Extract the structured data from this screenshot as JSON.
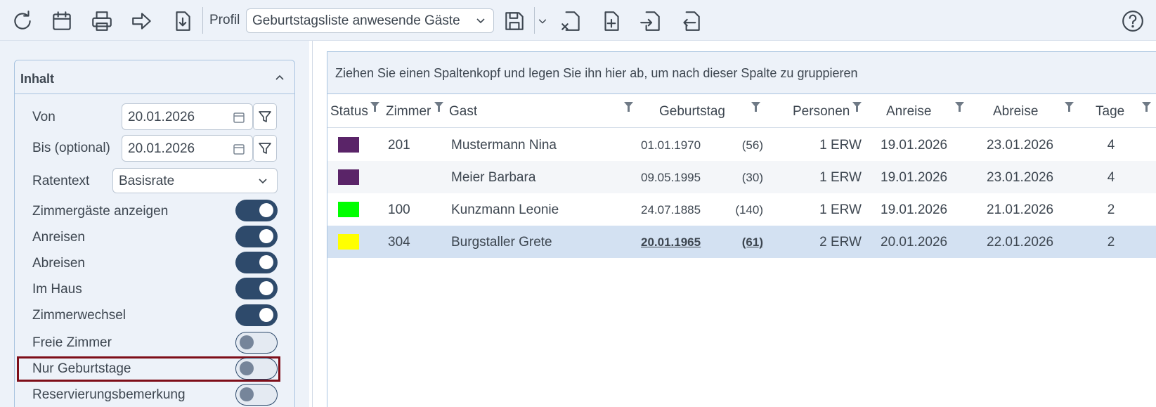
{
  "toolbar": {
    "icons": [
      "refresh-icon",
      "calendar-icon",
      "print-icon",
      "forward-icon",
      "download-icon",
      "save-icon",
      "excel-export-icon",
      "new-file-icon",
      "import-icon",
      "export-icon",
      "help-icon"
    ],
    "profil_label": "Profil",
    "profil_value": "Geburtstagsliste anwesende Gäste"
  },
  "panel": {
    "title": "Inhalt",
    "von_label": "Von",
    "von_value": "20.01.2026",
    "bis_label": "Bis (optional)",
    "bis_value": "20.01.2026",
    "ratentext_label": "Ratentext",
    "ratentext_value": "Basisrate",
    "toggles": [
      {
        "label": "Zimmergäste anzeigen",
        "on": true
      },
      {
        "label": "Anreisen",
        "on": true
      },
      {
        "label": "Abreisen",
        "on": true
      },
      {
        "label": "Im Haus",
        "on": true
      },
      {
        "label": "Zimmerwechsel",
        "on": true
      },
      {
        "label": "Freie Zimmer",
        "on": false
      },
      {
        "label": "Nur Geburtstage",
        "on": false
      },
      {
        "label": "Reservierungsbemerkung",
        "on": false
      }
    ]
  },
  "grid": {
    "group_hint": "Ziehen Sie einen Spaltenkopf und legen Sie ihn hier ab, um nach dieser Spalte zu gruppieren",
    "columns": {
      "status": "Status",
      "zimmer": "Zimmer",
      "gast": "Gast",
      "geburtstag": "Geburtstag",
      "personen": "Personen",
      "anreise": "Anreise",
      "abreise": "Abreise",
      "tage": "Tage"
    },
    "rows": [
      {
        "status_color": "#5a2468",
        "zimmer": "201",
        "gast": "Mustermann Nina",
        "geburtstag": "01.01.1970",
        "alter": "(56)",
        "personen": "1 ERW",
        "anreise": "19.01.2026",
        "abreise": "23.01.2026",
        "tage": "4"
      },
      {
        "status_color": "#5a2468",
        "zimmer": "",
        "gast": "Meier Barbara",
        "geburtstag": "09.05.1995",
        "alter": "(30)",
        "personen": "1 ERW",
        "anreise": "19.01.2026",
        "abreise": "23.01.2026",
        "tage": "4"
      },
      {
        "status_color": "#00ff00",
        "zimmer": "100",
        "gast": "Kunzmann Leonie",
        "geburtstag": "24.07.1885",
        "alter": "(140)",
        "personen": "1 ERW",
        "anreise": "19.01.2026",
        "abreise": "21.01.2026",
        "tage": "2"
      },
      {
        "status_color": "#ffff00",
        "zimmer": "304",
        "gast": "Burgstaller Grete",
        "geburtstag": "20.01.1965",
        "alter": "(61)",
        "personen": "2 ERW",
        "anreise": "20.01.2026",
        "abreise": "22.01.2026",
        "tage": "2"
      }
    ]
  },
  "colors": {
    "toolbar_bg": "#edf2f9",
    "toggle_on": "#2e4a6b",
    "selected_row": "#d3e1f2",
    "highlight_border": "#7e0e19"
  }
}
